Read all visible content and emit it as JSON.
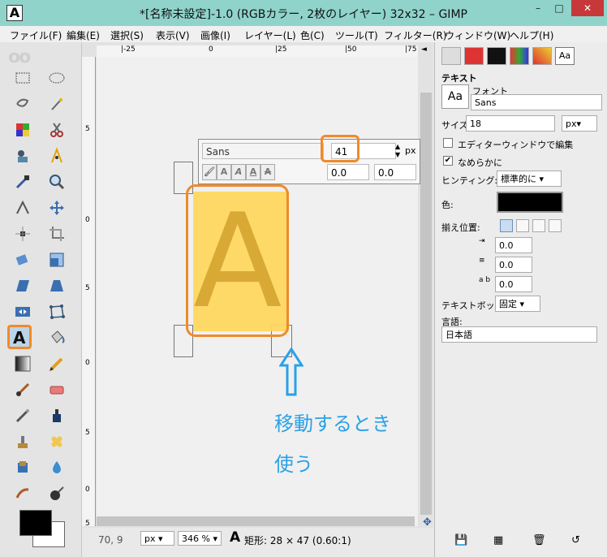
{
  "window": {
    "title": "*[名称未設定]-1.0 (RGBカラー, 2枚のレイヤー) 32x32 – GIMP",
    "app_icon": "A",
    "controls": {
      "minimize": "–",
      "maximize": "□",
      "close": "✕"
    }
  },
  "menu": [
    "ファイル(F)",
    "編集(E)",
    "選択(S)",
    "表示(V)",
    "画像(I)",
    "レイヤー(L)",
    "色(C)",
    "ツール(T)",
    "フィルター(R)",
    "ウィンドウ(W)",
    "ヘルプ(H)"
  ],
  "toolbox": {
    "logo": "oo",
    "tools": [
      [
        "rect-select-icon",
        "ellipse-select-icon"
      ],
      [
        "free-select-icon",
        "fuzzy-select-icon"
      ],
      [
        "color-select-icon",
        "scissors-icon"
      ],
      [
        "foreground-select-icon",
        "paths-icon"
      ],
      [
        "color-picker-icon",
        "zoom-icon"
      ],
      [
        "measure-icon",
        "move-icon"
      ],
      [
        "align-icon",
        "crop-icon"
      ],
      [
        "rotate-icon",
        "scale-icon"
      ],
      [
        "shear-icon",
        "perspective-icon"
      ],
      [
        "flip-icon",
        "cage-icon"
      ],
      [
        "text-icon",
        "bucket-fill-icon"
      ],
      [
        "gradient-icon",
        "pencil-icon"
      ],
      [
        "paintbrush-icon",
        "eraser-icon"
      ],
      [
        "airbrush-icon",
        "ink-icon"
      ],
      [
        "clone-icon",
        "heal-icon"
      ],
      [
        "perspective-clone-icon",
        "blur-icon"
      ],
      [
        "smudge-icon",
        "dodge-burn-icon"
      ]
    ],
    "selected_tool": "text-icon",
    "fg_color": "#000000",
    "bg_color": "#ffffff"
  },
  "canvas": {
    "ruler_h": [
      "|-25",
      "0",
      "|25",
      "|50",
      "|75"
    ],
    "ruler_v": [
      "5",
      "0",
      "5",
      "0",
      "5",
      "0",
      "5"
    ],
    "text_toolbar": {
      "font": "Sans",
      "size": "41",
      "unit": "px",
      "format_buttons": [
        "A",
        "A",
        "A",
        "A",
        "A"
      ],
      "baseline": "0.0",
      "kerning": "0.0"
    },
    "layer_glyph": "A",
    "layer_color": "#ffd760",
    "annotation": {
      "line1": "移動するとき",
      "line2": "使う",
      "color": "#2aa1e6"
    },
    "highlight_color": "#f08a2b"
  },
  "status": {
    "coords": "70, 9",
    "unit": "px",
    "zoom": "346 %",
    "message": "矩形: 28 × 47  (0.60:1)"
  },
  "dock": {
    "tabs": [
      "tool-options-icon",
      "device-status-icon",
      "undo-icon",
      "images-icon",
      "patterns-icon",
      "fonts-icon"
    ],
    "title": "テキスト",
    "font_label": "フォント",
    "font_value": "Sans",
    "size_label": "サイズ:",
    "size_value": "18",
    "size_unit": "px",
    "editor_check_label": "エディターウィンドウで編集",
    "editor_checked": false,
    "antialias_label": "なめらかに",
    "antialias_checked": true,
    "hinting_label": "ヒンティング:",
    "hinting_value": "標準的に",
    "color_label": "色:",
    "text_color": "#000000",
    "justify_label": "揃え位置:",
    "indent_value": "0.0",
    "line_spacing_value": "0.0",
    "letter_spacing_value": "0.0",
    "box_label": "テキストボックス:",
    "box_value": "固定",
    "language_label": "言語:",
    "language_value": "日本語"
  }
}
